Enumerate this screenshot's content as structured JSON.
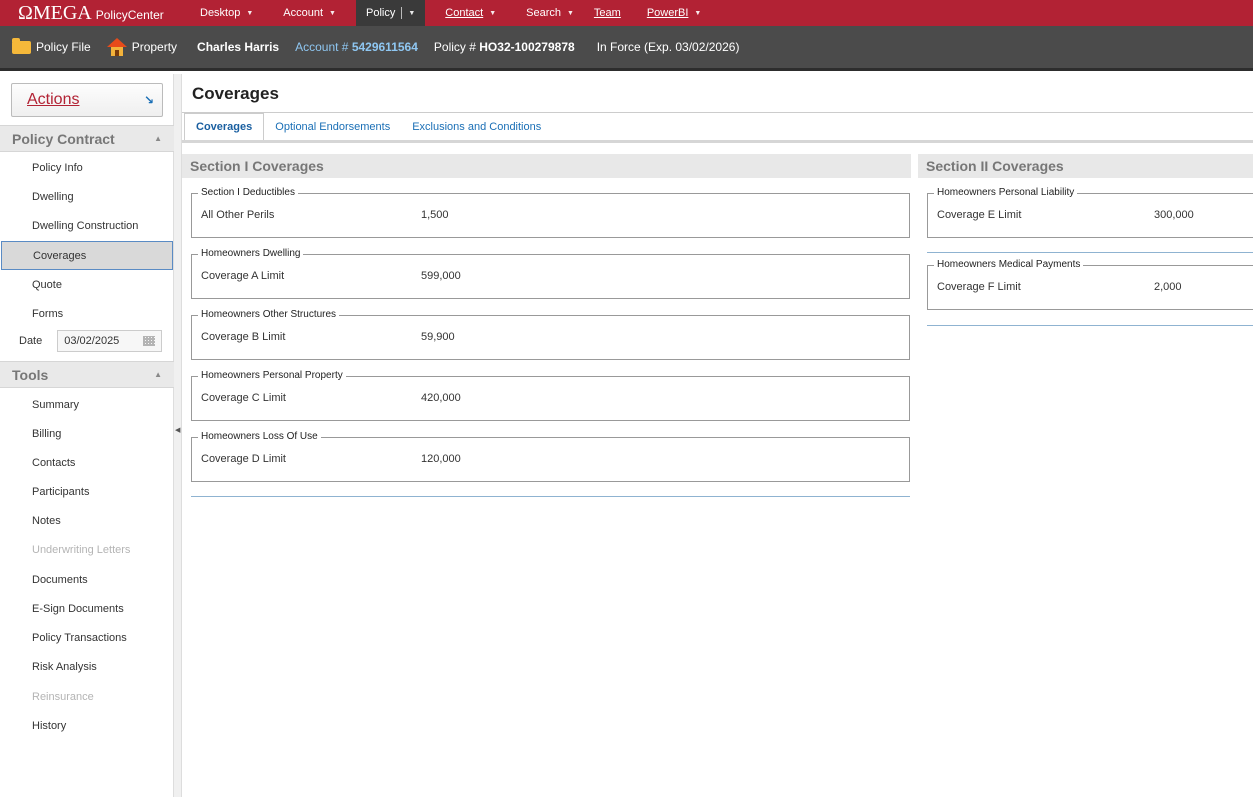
{
  "app": {
    "logo": "ΩMEGA",
    "product": "PolicyCenter"
  },
  "topnav": [
    {
      "label": "Desktop",
      "caret": true
    },
    {
      "label": "Account",
      "caret": true
    },
    {
      "label": "Policy",
      "caret": true,
      "active": true
    },
    {
      "label": "Contact",
      "caret": true
    },
    {
      "label": "Search",
      "caret": true
    },
    {
      "label": "Team",
      "caret": false
    },
    {
      "label": "PowerBI",
      "caret": true
    }
  ],
  "infobar": {
    "policy_file": "Policy File",
    "property": "Property",
    "insured": "Charles Harris",
    "account_prefix": "Account #",
    "account_number": "5429611564",
    "policy_prefix": "Policy #",
    "policy_number": "HO32-100279878",
    "status": "In Force (Exp. 03/02/2026)"
  },
  "sidebar": {
    "actions": "Actions",
    "policy_contract_heading": "Policy Contract",
    "policy_contract_items": [
      "Policy Info",
      "Dwelling",
      "Dwelling Construction",
      "Coverages",
      "Quote",
      "Forms"
    ],
    "date_label": "Date",
    "date_value": "03/02/2025",
    "tools_heading": "Tools",
    "tools_items": [
      "Summary",
      "Billing",
      "Contacts",
      "Participants",
      "Notes",
      "Underwriting Letters",
      "Documents",
      "E-Sign Documents",
      "Policy Transactions",
      "Risk Analysis",
      "Reinsurance",
      "History"
    ]
  },
  "main": {
    "title": "Coverages",
    "tabs": [
      "Coverages",
      "Optional Endorsements",
      "Exclusions and Conditions"
    ],
    "section1": {
      "heading": "Section I Coverages",
      "groups": [
        {
          "legend": "Section I Deductibles",
          "label": "All Other Perils",
          "value": "1,500"
        },
        {
          "legend": "Homeowners Dwelling",
          "label": "Coverage A Limit",
          "value": "599,000"
        },
        {
          "legend": "Homeowners Other Structures",
          "label": "Coverage B Limit",
          "value": "59,900"
        },
        {
          "legend": "Homeowners Personal Property",
          "label": "Coverage C Limit",
          "value": "420,000"
        },
        {
          "legend": "Homeowners Loss Of Use",
          "label": "Coverage D Limit",
          "value": "120,000"
        }
      ]
    },
    "section2": {
      "heading": "Section II Coverages",
      "groups": [
        {
          "legend": "Homeowners Personal Liability",
          "label": "Coverage E Limit",
          "value": "300,000"
        },
        {
          "legend": "Homeowners Medical Payments",
          "label": "Coverage F Limit",
          "value": "2,000"
        }
      ]
    }
  },
  "colors": {
    "brand_red": "#b22234",
    "infobar": "#4b4b4b",
    "link_blue": "#1a6fb6"
  }
}
